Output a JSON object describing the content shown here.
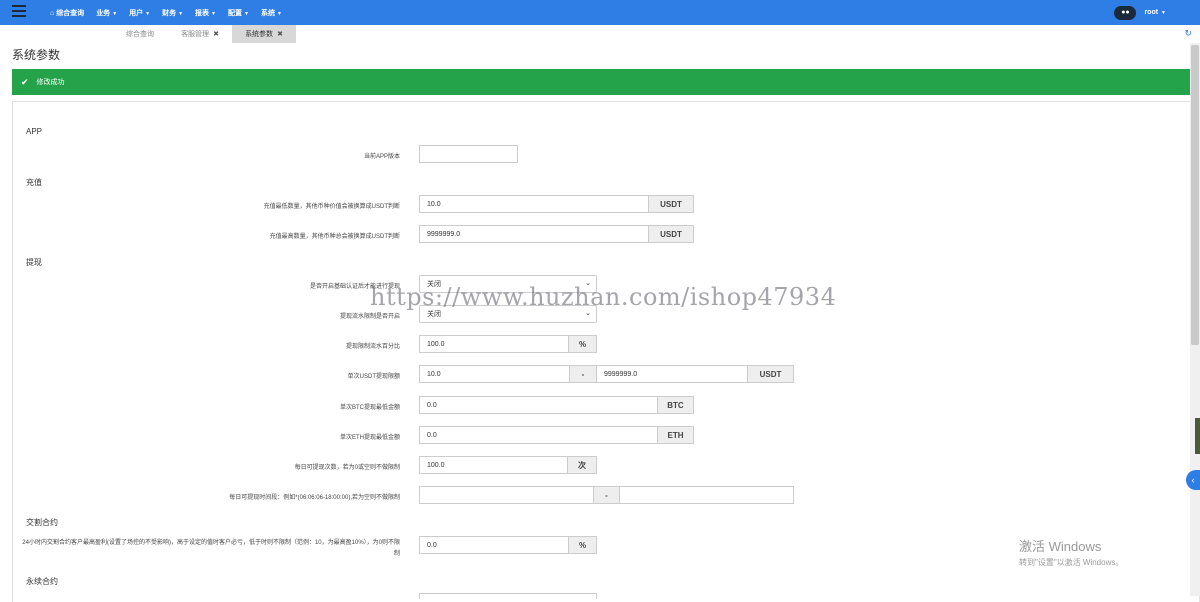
{
  "topnav": {
    "items": [
      "综合查询",
      "业务",
      "用户",
      "财务",
      "报表",
      "配置",
      "系统"
    ],
    "user": "root"
  },
  "tabs": [
    {
      "label": "综合查询"
    },
    {
      "label": "客服管理"
    },
    {
      "label": "系统参数"
    }
  ],
  "page_title": "系统参数",
  "alert": "修改成功",
  "sections": {
    "app": "APP",
    "recharge": "充值",
    "withdraw": "提现",
    "delivery": "交割合约",
    "perpetual": "永续合约"
  },
  "fields": {
    "app_version": {
      "label": "当前APP版本",
      "value": ""
    },
    "recharge_min": {
      "label": "充值最低数量，其他币种价值会被换算成USDT判断",
      "value": "10.0",
      "unit": "USDT"
    },
    "recharge_max": {
      "label": "充值最高数量，其他币种总会被换算成USDT判断",
      "value": "9999999.0",
      "unit": "USDT"
    },
    "withdraw_kyc": {
      "label": "是否开启基础认证后才能进行提现",
      "value": "关闭"
    },
    "withdraw_flow": {
      "label": "提现流水限制是否开启",
      "value": "关闭"
    },
    "withdraw_flow_pct": {
      "label": "提现限制流水百分比",
      "value": "100.0",
      "unit": "%"
    },
    "withdraw_usdt": {
      "label": "单次USDT提现限额",
      "min": "10.0",
      "sep": "-",
      "max": "9999999.0",
      "unit": "USDT"
    },
    "withdraw_btc": {
      "label": "单次BTC提现最低金额",
      "value": "0.0",
      "unit": "BTC"
    },
    "withdraw_eth": {
      "label": "单次ETH提现最低金额",
      "value": "0.0",
      "unit": "ETH"
    },
    "withdraw_times": {
      "label": "每日可提现次数，若为0或空则不做限制",
      "value": "100.0",
      "unit": "次"
    },
    "withdraw_time": {
      "label": "每日可提现时间段：例如*(06:06:06-18:00:00),若为空则不做限制",
      "start": "",
      "sep": "-",
      "end": ""
    },
    "delivery_profit": {
      "label": "24小时内交割合约客户最高盈利(设置了场控的不受影响)，高于设定的值时客户必亏，低于时则不限制（范例：10，为最高盈10%），为0则不限制",
      "value": "0.0",
      "unit": "%"
    }
  },
  "watermark": "https://www.huzhan.com/ishop47934",
  "windows_activation": {
    "line1": "激活 Windows",
    "line2": "转到\"设置\"以激活 Windows。"
  },
  "icons": [
    "menu-icon",
    "home-icon",
    "chat-icon",
    "close-icon",
    "refresh-icon",
    "check-icon",
    "chevron-down-icon",
    "chevron-left-icon"
  ]
}
